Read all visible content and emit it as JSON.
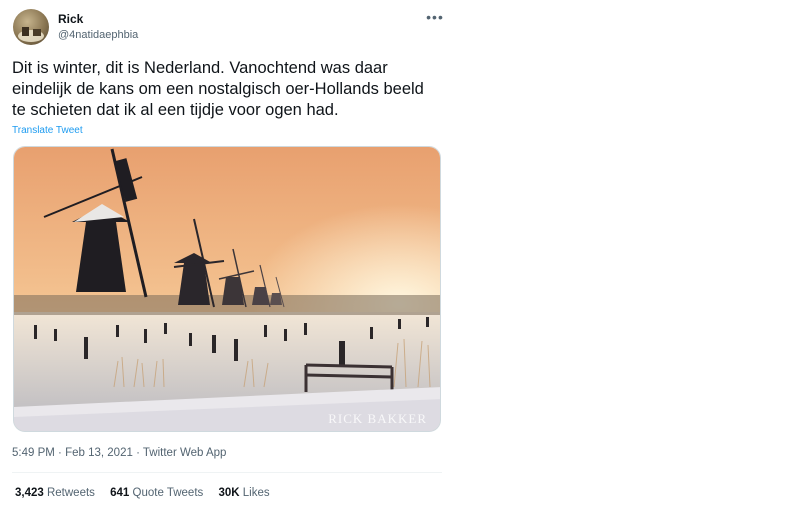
{
  "author": {
    "name": "Rick",
    "handle": "@4natidaephbia"
  },
  "tweet": {
    "text": "Dit is winter, dit is Nederland. Vanochtend was daar eindelijk de kans om een nostalgisch oer-Hollands beeld te schieten dat ik al een tijdje voor ogen had.",
    "translate_label": "Translate Tweet",
    "media": {
      "watermark": "RICK BAKKER"
    },
    "time": "5:49 PM",
    "date": "Feb 13, 2021",
    "separator": "·",
    "source": "Twitter Web App"
  },
  "stats": {
    "retweets_count": "3,423",
    "retweets_label": "Retweets",
    "quotes_count": "641",
    "quotes_label": "Quote Tweets",
    "likes_count": "30K",
    "likes_label": "Likes"
  },
  "icons": {
    "more": "more-options-icon"
  }
}
